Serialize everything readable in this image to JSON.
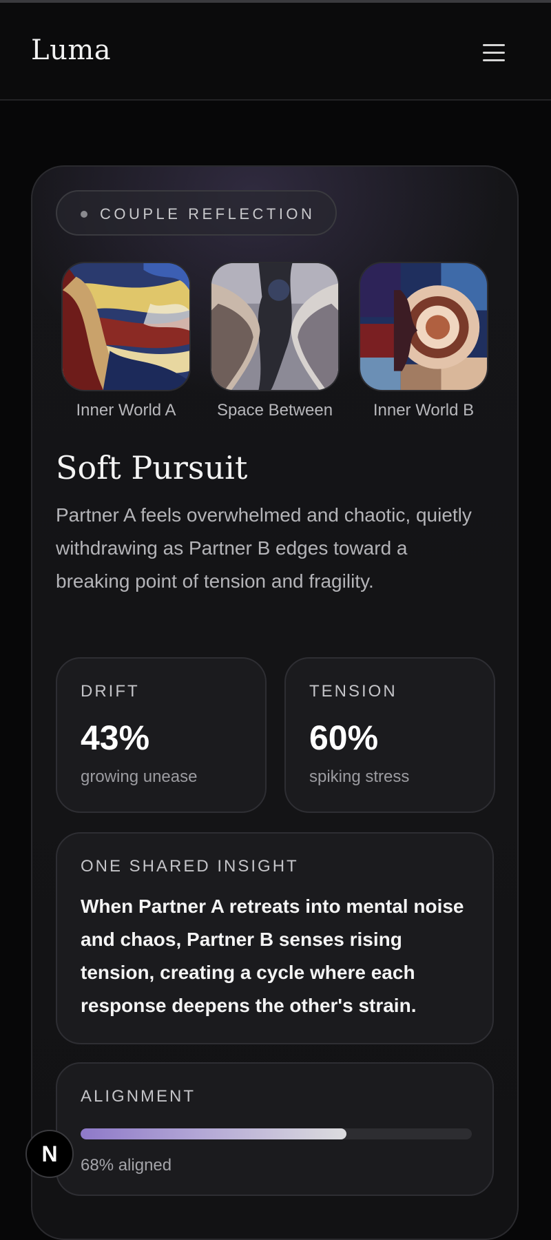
{
  "app": {
    "name": "Luma"
  },
  "header": {
    "menu_icon": "hamburger-menu-icon"
  },
  "card": {
    "badge": "COUPLE REFLECTION",
    "images": [
      {
        "label": "Inner World A"
      },
      {
        "label": "Space Between"
      },
      {
        "label": "Inner World B"
      }
    ],
    "title": "Soft Pursuit",
    "description": "Partner A feels overwhelmed and chaotic, quietly withdrawing as Partner B edges toward a breaking point of tension and fragility.",
    "stats": [
      {
        "label": "DRIFT",
        "value": "43%",
        "sub": "growing unease"
      },
      {
        "label": "TENSION",
        "value": "60%",
        "sub": "spiking stress"
      }
    ],
    "insight": {
      "label": "ONE SHARED INSIGHT",
      "text": "When Partner A retreats into mental noise and chaos, Partner B senses rising tension, creating a cycle where each response deepens the other's strain."
    },
    "alignment": {
      "label": "ALIGNMENT",
      "percent": 68,
      "sub": "68% aligned"
    }
  },
  "dev_badge": {
    "letter": "N"
  },
  "colors": {
    "background": "#070708",
    "card": "#151518",
    "accent": "#8e79c9"
  }
}
